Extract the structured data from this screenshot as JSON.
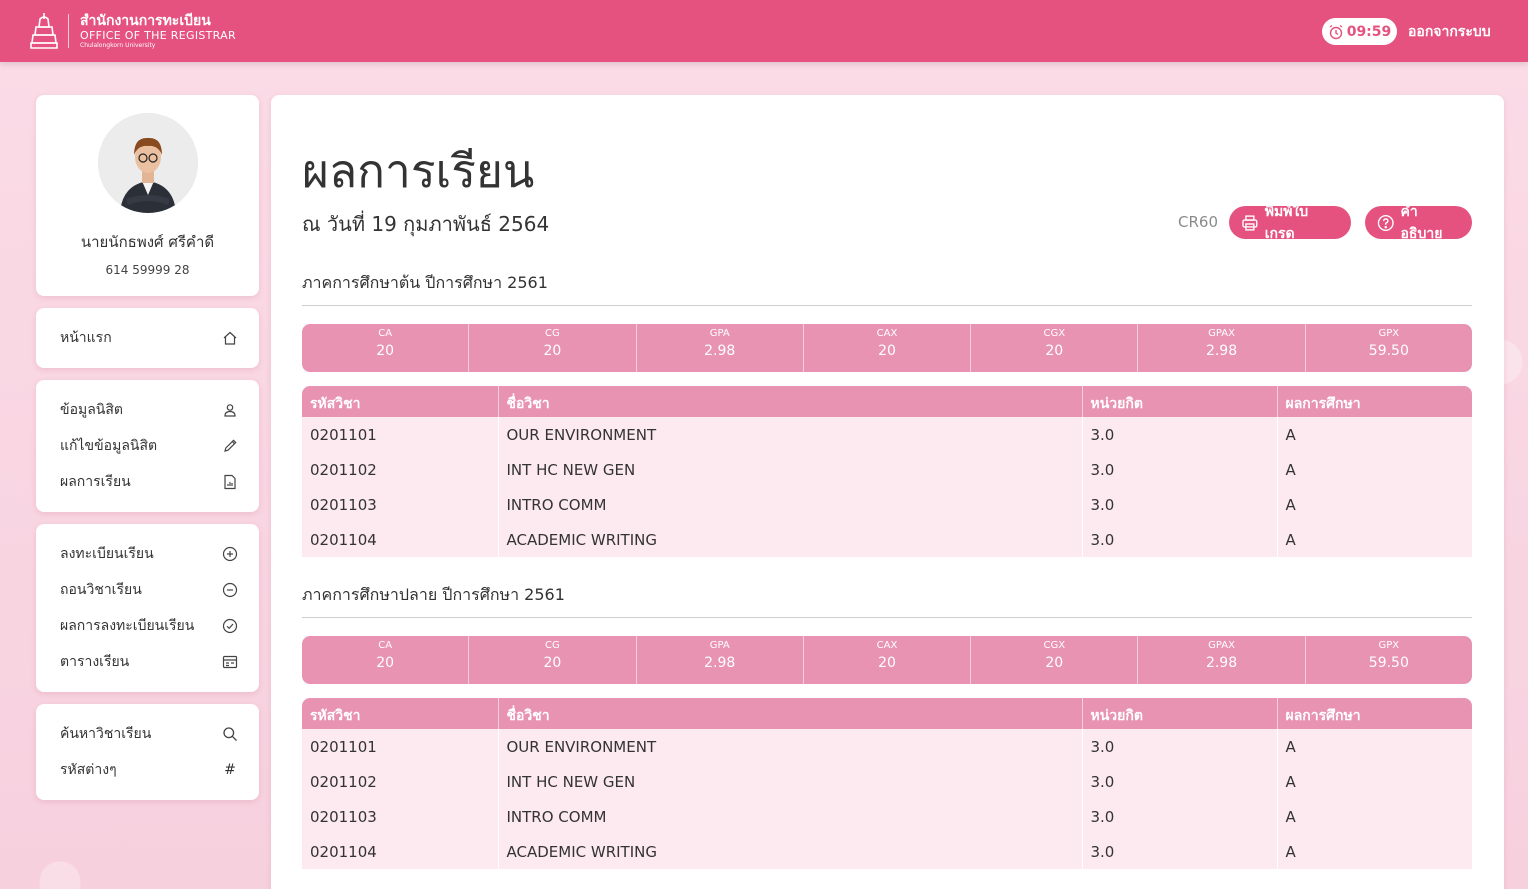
{
  "header": {
    "logo_th": "สำนักงานการทะเบียน",
    "logo_en": "OFFICE OF THE REGISTRAR",
    "logo_uni": "Chulalongkorn University",
    "timer": "09:59",
    "logout": "ออกจากระบบ"
  },
  "profile": {
    "name": "นายนักธพงศ์ ศรีคำดี",
    "student_id": "614 59999 28"
  },
  "sidebar": {
    "home": "หน้าแรก",
    "student_info": "ข้อมูลนิสิต",
    "edit_info": "แก้ไขข้อมูลนิสิต",
    "results": "ผลการเรียน",
    "register": "ลงทะเบียนเรียน",
    "withdraw": "ถอนวิชาเรียน",
    "reg_results": "ผลการลงทะเบียนเรียน",
    "schedule": "ตารางเรียน",
    "search": "ค้นหาวิชาเรียน",
    "codes": "รหัสต่างๆ",
    "codes_symbol": "#"
  },
  "main": {
    "title": "ผลการเรียน",
    "as_of": "ณ วันที่ 19 กุมภาพันธ์ 2564",
    "code": "CR60",
    "print_label": "พิมพ์ใบเกรด",
    "help_label": "คำอธิบาย"
  },
  "table_headers": [
    "รหัสวิชา",
    "ชื่อวิชา",
    "หน่วยกิต",
    "ผลการศึกษา"
  ],
  "semesters": [
    {
      "title": "ภาคการศึกษาต้น ปีการศึกษา 2561",
      "stats": [
        {
          "label": "CA",
          "value": "20"
        },
        {
          "label": "CG",
          "value": "20"
        },
        {
          "label": "GPA",
          "value": "2.98"
        },
        {
          "label": "CAX",
          "value": "20"
        },
        {
          "label": "CGX",
          "value": "20"
        },
        {
          "label": "GPAX",
          "value": "2.98"
        },
        {
          "label": "GPX",
          "value": "59.50"
        }
      ],
      "courses": [
        {
          "code": "0201101",
          "name": "OUR ENVIRONMENT",
          "credit": "3.0",
          "grade": "A"
        },
        {
          "code": "0201102",
          "name": "INT HC NEW GEN",
          "credit": "3.0",
          "grade": "A"
        },
        {
          "code": "0201103",
          "name": "INTRO COMM",
          "credit": "3.0",
          "grade": "A"
        },
        {
          "code": "0201104",
          "name": "ACADEMIC WRITING",
          "credit": "3.0",
          "grade": "A"
        }
      ]
    },
    {
      "title": "ภาคการศึกษาปลาย ปีการศึกษา 2561",
      "stats": [
        {
          "label": "CA",
          "value": "20"
        },
        {
          "label": "CG",
          "value": "20"
        },
        {
          "label": "GPA",
          "value": "2.98"
        },
        {
          "label": "CAX",
          "value": "20"
        },
        {
          "label": "CGX",
          "value": "20"
        },
        {
          "label": "GPAX",
          "value": "2.98"
        },
        {
          "label": "GPX",
          "value": "59.50"
        }
      ],
      "courses": [
        {
          "code": "0201101",
          "name": "OUR ENVIRONMENT",
          "credit": "3.0",
          "grade": "A"
        },
        {
          "code": "0201102",
          "name": "INT HC NEW GEN",
          "credit": "3.0",
          "grade": "A"
        },
        {
          "code": "0201103",
          "name": "INTRO COMM",
          "credit": "3.0",
          "grade": "A"
        },
        {
          "code": "0201104",
          "name": "ACADEMIC WRITING",
          "credit": "3.0",
          "grade": "A"
        }
      ]
    }
  ]
}
